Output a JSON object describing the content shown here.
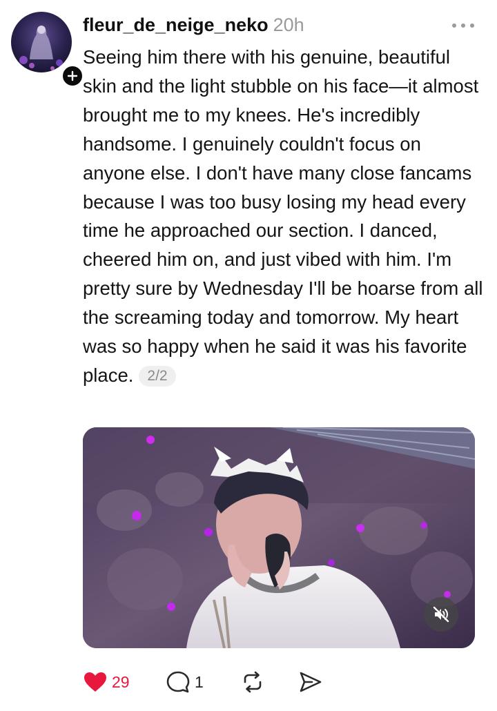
{
  "post": {
    "username": "fleur_de_neige_neko",
    "timestamp": "20h",
    "body": "Seeing him there with his genuine, beautiful skin and the light stubble on his face—it almost brought me to my knees. He's incredibly handsome. I genuinely couldn't focus on anyone else. I don't have many close fancams because I was too busy losing my head every time he approached our section. I danced, cheered him on, and just vibed with him. I'm pretty sure by Wednesday I'll be hoarse from all the screaming today and tomorrow. My heart was so happy when he said it was his favorite place.",
    "page_indicator": "2/2"
  },
  "actions": {
    "like_count": "29",
    "reply_count": "1"
  },
  "icons": {
    "avatar": "profile-avatar",
    "follow": "plus-icon",
    "more": "more-dots-icon",
    "mute": "speaker-muted-icon",
    "like": "heart-icon",
    "reply": "comment-bubble-icon",
    "repost": "repost-icon",
    "share": "send-icon"
  },
  "colors": {
    "like_active": "#e8173e",
    "timestamp": "#9a9a9a",
    "text": "#141414"
  }
}
